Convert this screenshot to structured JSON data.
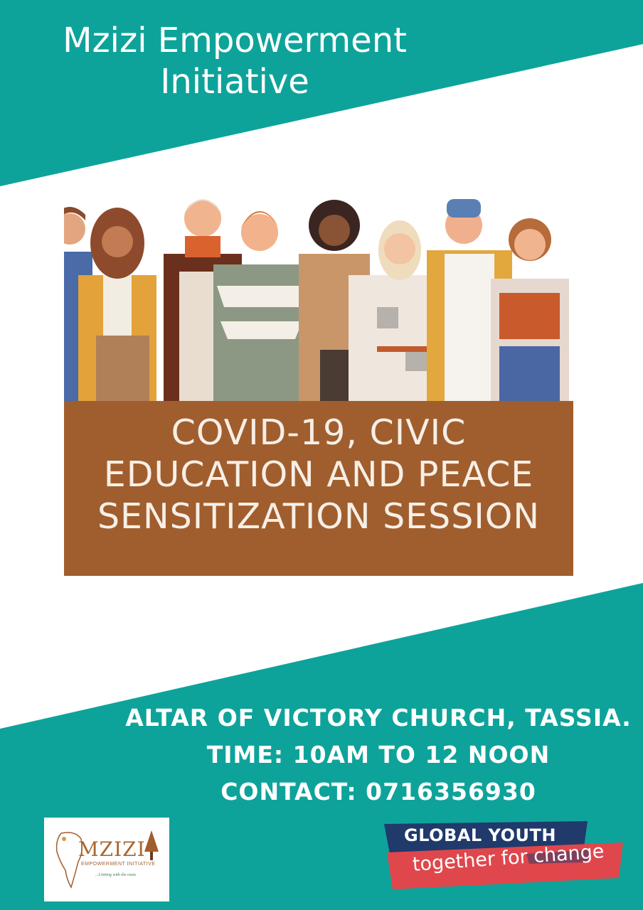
{
  "header": {
    "title_line1": "Mzizi Empowerment",
    "title_line2": "Initiative"
  },
  "event": {
    "lines": [
      "COVID-19, CIVIC",
      "EDUCATION AND PEACE",
      "SENSITIZATION SESSION"
    ]
  },
  "details": {
    "venue": "ALTAR OF VICTORY CHURCH, TASSIA.",
    "time": "TIME: 10AM TO 12 NOON",
    "contact": "CONTACT: 0716356930"
  },
  "logo": {
    "word": "MZIZI",
    "subtitle": "EMPOWERMENT INITIATIVE",
    "tagline": "...Uniting with the roots"
  },
  "badge": {
    "line1": "GLOBAL YOUTH",
    "line2": "together for change"
  },
  "colors": {
    "teal": "#0ea39a",
    "brown": "#a05e2e",
    "navy": "#1f3a6b",
    "red": "#e0474c"
  }
}
